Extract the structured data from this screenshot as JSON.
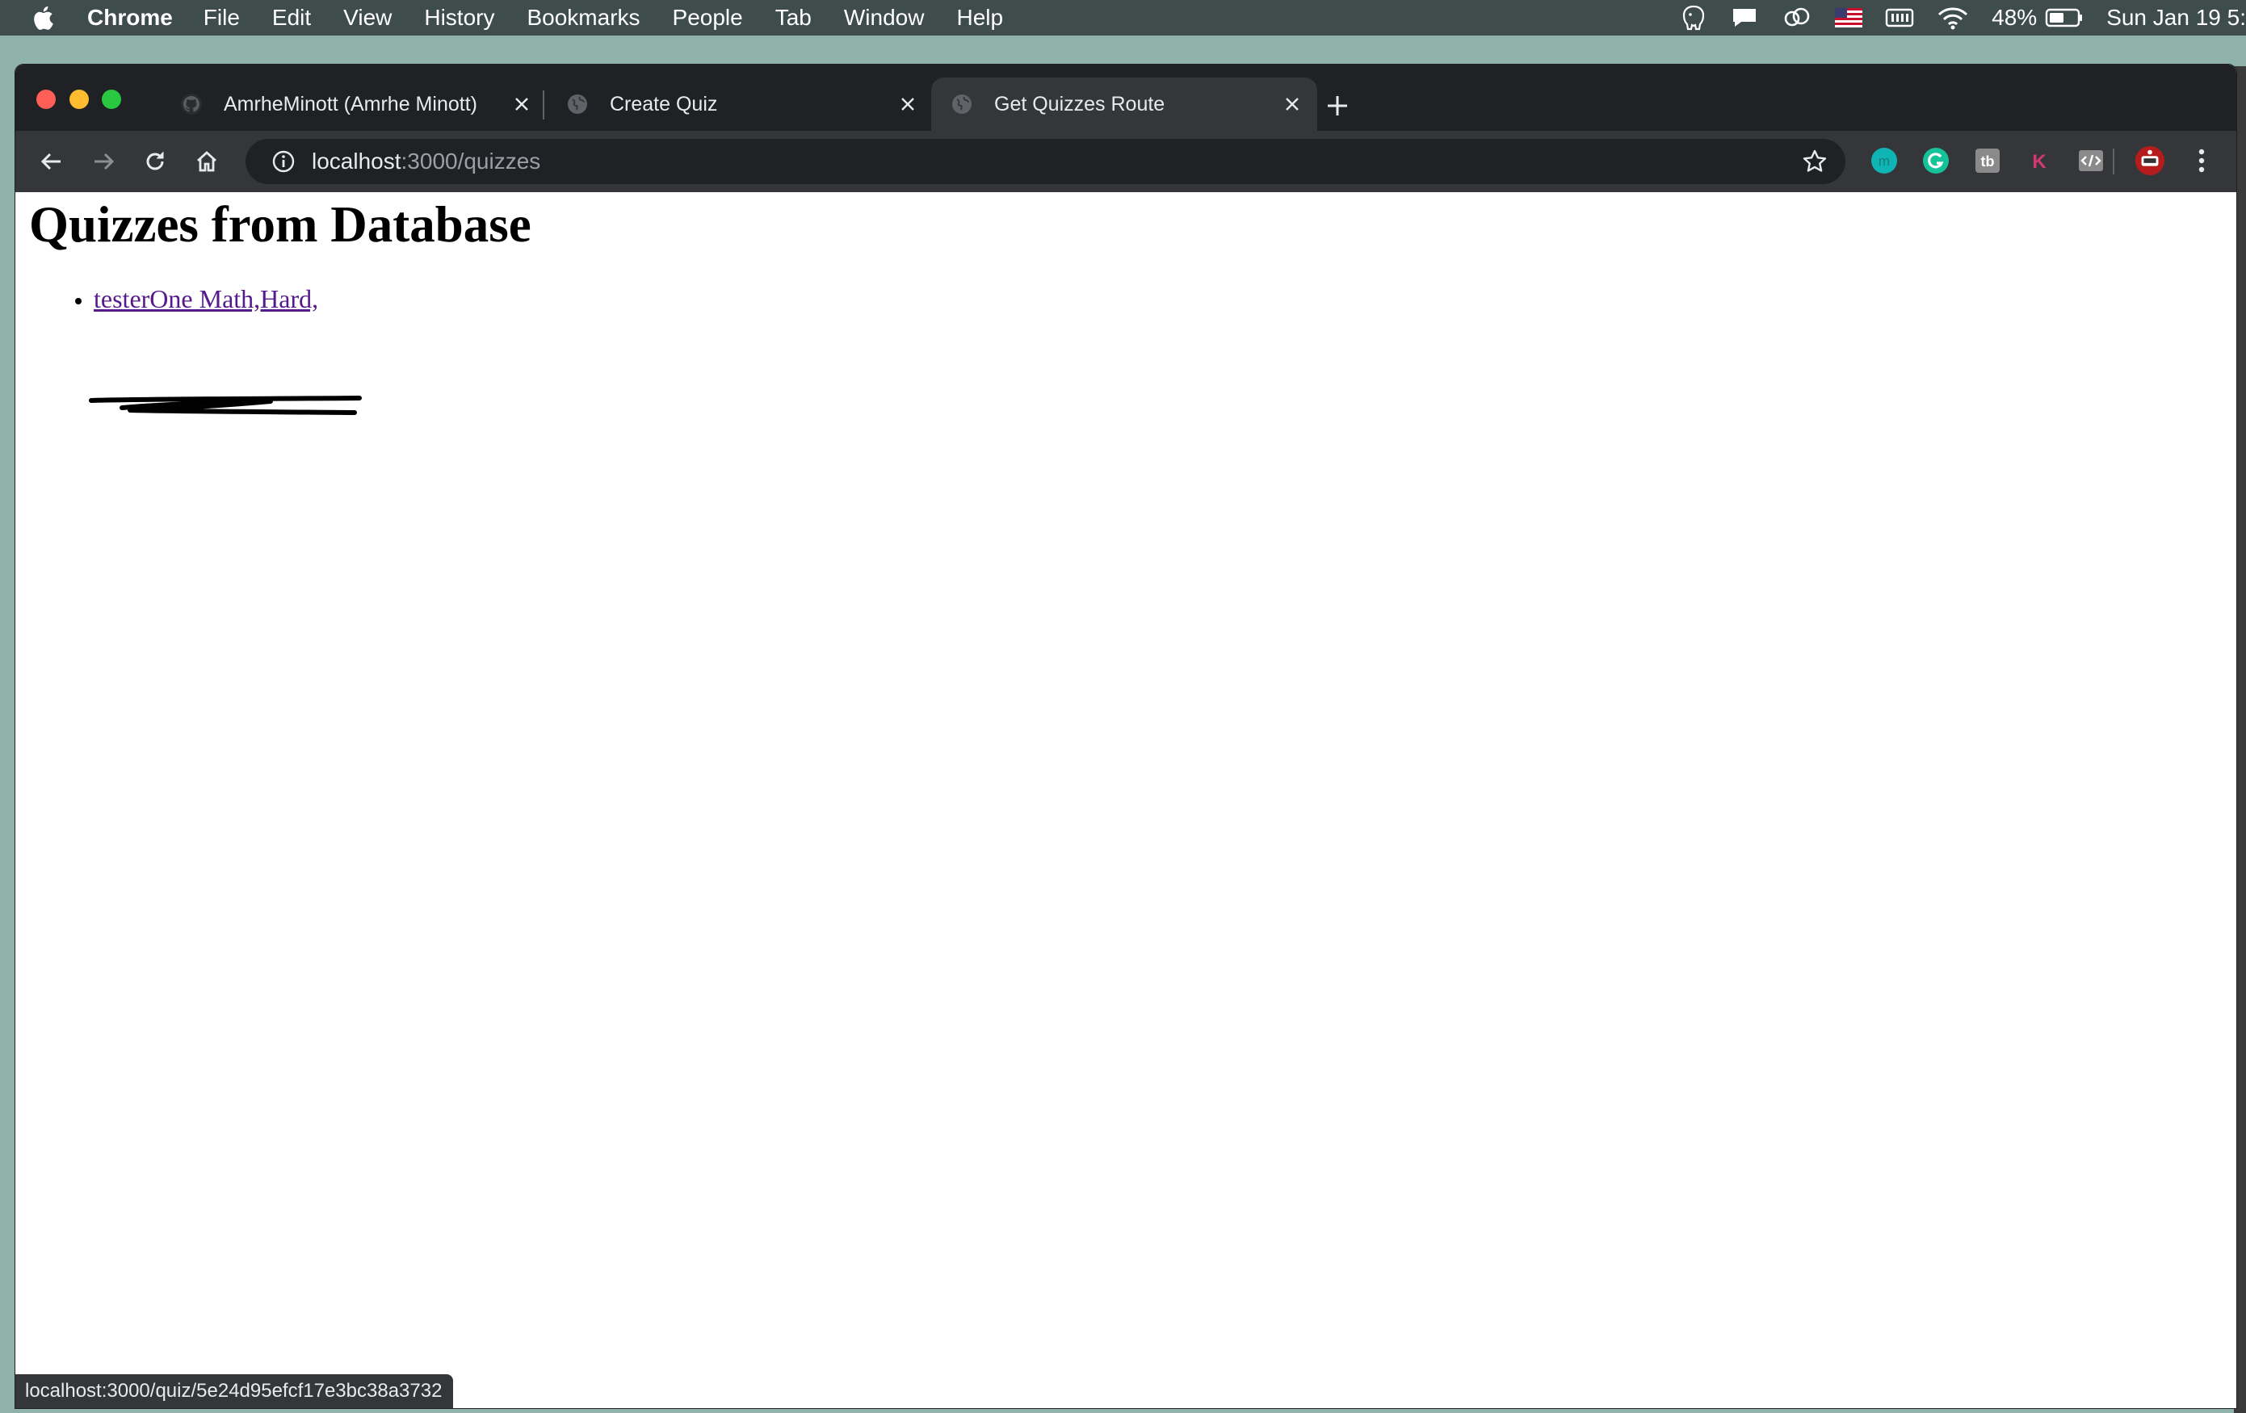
{
  "menubar": {
    "app_name": "Chrome",
    "items": [
      "File",
      "Edit",
      "View",
      "History",
      "Bookmarks",
      "People",
      "Tab",
      "Window",
      "Help"
    ],
    "status": {
      "battery_percent": "48%",
      "datetime": "Sun Jan 19  5:"
    }
  },
  "tabs": [
    {
      "title": "AmrheMinott (Amrhe Minott)",
      "favicon": "github-icon",
      "active": false
    },
    {
      "title": "Create Quiz",
      "favicon": "globe-icon",
      "active": false
    },
    {
      "title": "Get Quizzes Route",
      "favicon": "globe-icon",
      "active": true
    }
  ],
  "omnibox": {
    "host": "localhost",
    "path": ":3000/quizzes"
  },
  "extensions": [
    {
      "name": "m-extension-icon",
      "color": "#0fb5b5"
    },
    {
      "name": "grammarly-icon",
      "color": "#15c39a"
    },
    {
      "name": "tb-extension-icon",
      "color": "#8a8a8a"
    },
    {
      "name": "k-extension-icon",
      "color": "#d4396e"
    },
    {
      "name": "code-extension-icon",
      "color": "#8a8a8a"
    }
  ],
  "page": {
    "heading": "Quizzes from Database",
    "quizzes": [
      {
        "label": "testerOne Math,Hard,"
      }
    ]
  },
  "status_bar": {
    "url": "localhost:3000/quiz/5e24d95efcf17e3bc38a3732"
  },
  "colors": {
    "link_visited": "#551a8b",
    "chrome_dark": "#202124",
    "chrome_toolbar": "#35363a",
    "menubar_bg": "#3f4c4c"
  }
}
